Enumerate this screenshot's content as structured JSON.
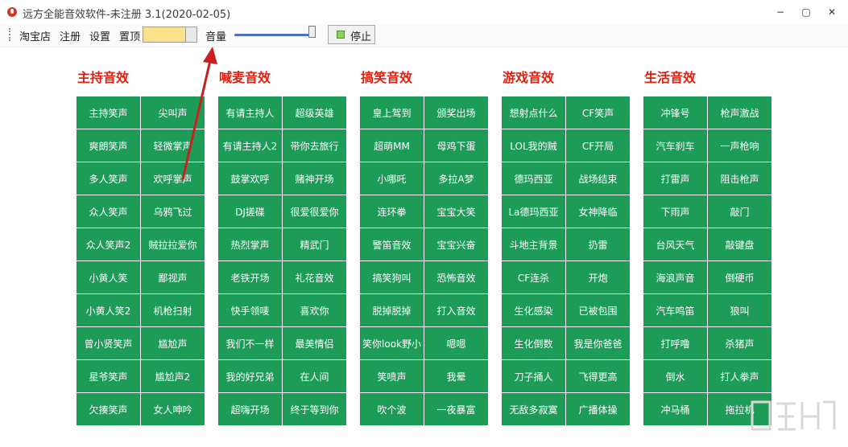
{
  "window": {
    "title": "远方全能音效软件-未注册 3.1(2020-02-05)",
    "minimize": "−",
    "maximize": "▢",
    "close": "✕"
  },
  "toolbar": {
    "menus": [
      "淘宝店",
      "注册",
      "设置",
      "置顶"
    ],
    "volume_label": "音量",
    "volume_level": 0.95,
    "stop_label": "停止",
    "color_swatch": "#fce28a"
  },
  "colors": {
    "section_title": "#e01f0f",
    "button_bg": "#1d9c57",
    "arrow": "#c91f1f"
  },
  "sections": [
    {
      "title": "主持音效",
      "buttons": [
        "主持笑声",
        "尖叫声",
        "爽朗笑声",
        "轻微掌声",
        "多人笑声",
        "欢呼掌声",
        "众人笑声",
        "乌鸦飞过",
        "众人笑声2",
        "贼拉拉爱你",
        "小黄人笑",
        "鄙视声",
        "小黄人笑2",
        "机枪扫射",
        "曾小贤笑声",
        "尴尬声",
        "星爷笑声",
        "尴尬声2",
        "欠揍笑声",
        "女人呻吟"
      ]
    },
    {
      "title": "喊麦音效",
      "buttons": [
        "有请主持人",
        "超级英雄",
        "有请主持人2",
        "带你去旅行",
        "鼓掌欢呼",
        "赌神开场",
        "DJ搓碟",
        "很爱很爱你",
        "热烈掌声",
        "精武门",
        "老铁开场",
        "礼花音效",
        "快手领唛",
        "喜欢你",
        "我们不一样",
        "最美情侣",
        "我的好兄弟",
        "在人间",
        "超嗨开场",
        "终于等到你"
      ]
    },
    {
      "title": "搞笑音效",
      "buttons": [
        "皇上驾到",
        "颁奖出场",
        "超萌MM",
        "母鸡下蛋",
        "小哪吒",
        "多拉A梦",
        "连环拳",
        "宝宝大笑",
        "警笛音效",
        "宝宝兴奋",
        "搞笑狗叫",
        "恐怖音效",
        "脱掉脱掉",
        "打入音效",
        "笑你look野小",
        "嗯嗯",
        "笑喷声",
        "我晕",
        "吹个波",
        "一夜暴富"
      ]
    },
    {
      "title": "游戏音效",
      "buttons": [
        "想射点什么",
        "CF笑声",
        "LOL我的贼",
        "CF开局",
        "德玛西亚",
        "战场结束",
        "La德玛西亚",
        "女神降临",
        "斗地主背景",
        "扔雷",
        "CF连杀",
        "开炮",
        "生化感染",
        "已被包围",
        "生化倒数",
        "我是你爸爸",
        "刀子捅人",
        "飞得更高",
        "无敌多寂寞",
        "广播体操"
      ]
    },
    {
      "title": "生活音效",
      "buttons": [
        "冲锋号",
        "枪声激战",
        "汽车刹车",
        "一声枪响",
        "打雷声",
        "阻击枪声",
        "下雨声",
        "敲门",
        "台风天气",
        "敲键盘",
        "海浪声音",
        "倒硬币",
        "汽车鸣笛",
        "狼叫",
        "打呼噜",
        "杀猪声",
        "倒水",
        "打人拳声",
        "冲马桶",
        "拖拉机"
      ]
    }
  ]
}
